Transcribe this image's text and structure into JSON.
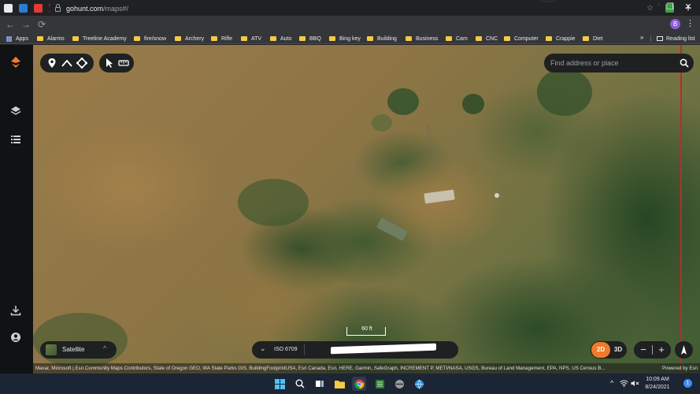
{
  "browser": {
    "tabs_favicon_colors": [
      "#e8eaed",
      "#2b7cd3",
      "#e53935",
      "#c62828",
      "#c62828",
      "#c62828",
      "#c62828",
      "#c62828",
      "#c62828",
      "#7cb342",
      "#e8eaed",
      "#d32f2f",
      "#8d6e63",
      "#9e9e9e",
      "#4285f4",
      "#42a5f5",
      "#ffffff",
      "#f57c00",
      "#ffffff",
      "#ffffff",
      "#e53935",
      "#e53935",
      "#2e7d32",
      "#ffffff",
      "#43a047",
      "#ffffff",
      "#1976d2",
      "#b71c1c",
      "#673ab7",
      "#e53935",
      "#2e7d32",
      "#2e7d32",
      "#43a047",
      "#43a047",
      "#1e88e5",
      "#e8eaed",
      "#c2185b",
      "#fdd835",
      "#00c853",
      "#e91e63",
      "#9e9e9e",
      "#2e7d32",
      "#ffffff",
      "#43a047"
    ],
    "active_tab_close": "×",
    "new_tab": "+",
    "tab_search": "⌄",
    "window_minimize": "—",
    "window_maximize": "❐",
    "window_close": "✕",
    "nav": {
      "back": "←",
      "forward": "→",
      "reload": "⟳"
    },
    "url_host": "gohunt.com",
    "url_path": "/maps#/",
    "bookmark_star": "☆",
    "profile_initial": "B",
    "menu": "⋮",
    "bookmarks": [
      {
        "label": "Apps",
        "kind": "apps"
      },
      {
        "label": "Alarms",
        "kind": "folder"
      },
      {
        "label": "Treeline Academy",
        "kind": "folder"
      },
      {
        "label": "fire/snow",
        "kind": "folder"
      },
      {
        "label": "Archery",
        "kind": "folder"
      },
      {
        "label": "Rifle",
        "kind": "folder"
      },
      {
        "label": "ATV",
        "kind": "folder"
      },
      {
        "label": "Auto",
        "kind": "folder"
      },
      {
        "label": "BBQ",
        "kind": "folder"
      },
      {
        "label": "Bing key",
        "kind": "folder"
      },
      {
        "label": "Building",
        "kind": "folder"
      },
      {
        "label": "Business",
        "kind": "folder"
      },
      {
        "label": "Cam",
        "kind": "folder"
      },
      {
        "label": "CNC",
        "kind": "folder"
      },
      {
        "label": "Computer",
        "kind": "folder"
      },
      {
        "label": "Crappie",
        "kind": "folder"
      },
      {
        "label": "Diet",
        "kind": "folder"
      }
    ],
    "bookmarks_more": "»",
    "reading_list": "Reading list"
  },
  "map": {
    "search_placeholder": "Find address or place",
    "scale_label": "60 ft",
    "basemap_label": "Satellite",
    "basemap_chevron": "^",
    "info_chevron": "⌄",
    "iso_label": "ISO 6709",
    "dim_2d": "2D",
    "dim_3d": "3D",
    "zoom_out": "−",
    "zoom_in": "+",
    "attribution": "Maxar, Microsoft | Esri Community Maps Contributors, State of Oregon GEO, WA State Parks GIS, BuildingFootprintUSA, Esri Canada, Esri, HERE, Garmin, SafeGraph, INCREMENT P, METI/NASA, USGS, Bureau of Land Management, EPA, NPS, US Census B...",
    "powered_by": "Powered by Esri",
    "accent_color": "#f07b2b",
    "boundary_color": "#c0282b"
  },
  "taskbar": {
    "time": "10:09 AM",
    "date": "8/24/2021",
    "notification_count": "1",
    "tray_chevron": "^"
  }
}
